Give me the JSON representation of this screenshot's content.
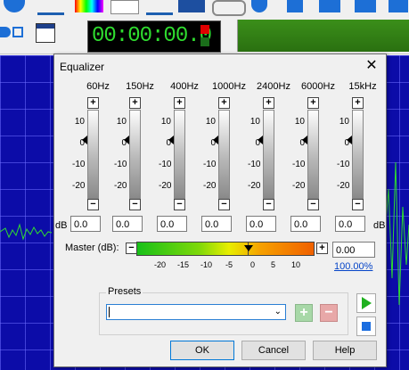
{
  "app": {
    "timer": "00:00:00.0",
    "toolbar_icons": [
      "down-arrow-icon",
      "mixer-icon",
      "spectrum-icon",
      "tape-icon",
      "waveform-icon",
      "scissors-icon",
      "recorder-icon",
      "arrow-up-icon",
      "arrow-down-icon",
      "arrow-left-icon",
      "arrow-corner-icon"
    ]
  },
  "dialog": {
    "title": "Equalizer",
    "close_glyph": "✕",
    "bands": [
      {
        "label": "60Hz",
        "value": "0.0"
      },
      {
        "label": "150Hz",
        "value": "0.0"
      },
      {
        "label": "400Hz",
        "value": "0.0"
      },
      {
        "label": "1000Hz",
        "value": "0.0"
      },
      {
        "label": "2400Hz",
        "value": "0.0"
      },
      {
        "label": "6000Hz",
        "value": "0.0"
      },
      {
        "label": "15kHz",
        "value": "0.0"
      }
    ],
    "scale_ticks": [
      "10",
      "0",
      "-10",
      "-20"
    ],
    "db_left": "dB",
    "db_right": "dB",
    "master": {
      "label": "Master (dB):",
      "value": "0.00",
      "percent": "100.00%",
      "scale": [
        "-20",
        "-15",
        "-10",
        "-5",
        "0",
        "5",
        "10"
      ]
    },
    "presets": {
      "label": "Presets",
      "value": ""
    },
    "buttons": {
      "ok": "OK",
      "cancel": "Cancel",
      "help": "Help"
    },
    "colors": {
      "play": "#1fb01f",
      "stop": "#1a6de0"
    }
  }
}
